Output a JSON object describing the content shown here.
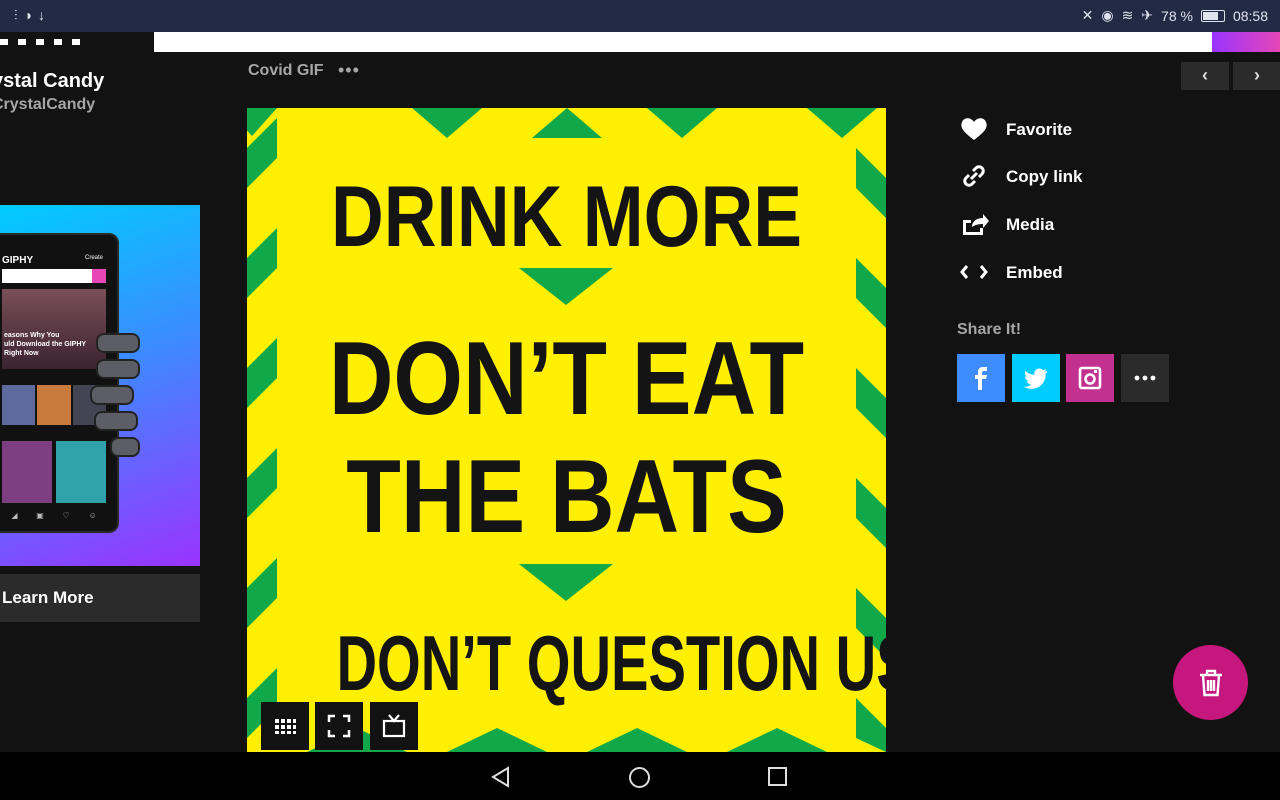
{
  "status_bar": {
    "left_icons": [
      "sim-icon",
      "moon-icon",
      "download-icon"
    ],
    "right_icons": [
      "mute-icon",
      "eye-icon",
      "wifi-icon",
      "airplane-icon"
    ],
    "battery_percent": "78 %",
    "time": "08:58"
  },
  "channel": {
    "name": "ystal Candy",
    "handle": "CrystalCandy"
  },
  "promo": {
    "phone_title": "GIPHY",
    "phone_create": "Create",
    "phone_headline": "easons Why You\nuld Download the GIPHY\nRight Now",
    "cta_label": "Learn More"
  },
  "gif": {
    "title": "Covid GIF",
    "more_label": "•••",
    "lines": [
      "DRINK MORE",
      "DON’T EAT",
      "THE BATS",
      "DON’T QUESTION US"
    ],
    "colors": {
      "background": "#ffef00",
      "stripe": "#11a84a",
      "text": "#141414"
    }
  },
  "nav": {
    "prev_label": "‹",
    "next_label": "›"
  },
  "actions": [
    {
      "label": "Favorite",
      "icon": "heart-icon"
    },
    {
      "label": "Copy link",
      "icon": "link-icon"
    },
    {
      "label": "Media",
      "icon": "share-out-icon"
    },
    {
      "label": "Embed",
      "icon": "code-icon"
    }
  ],
  "share": {
    "label": "Share It!",
    "buttons": [
      {
        "name": "facebook",
        "color": "#3f8cff"
      },
      {
        "name": "twitter",
        "color": "#00ccff"
      },
      {
        "name": "instagram",
        "color": "#c2318f"
      },
      {
        "name": "more",
        "color": "#2b2b2b"
      }
    ]
  },
  "fab": {
    "icon": "trash-icon",
    "color": "#c5177d"
  }
}
